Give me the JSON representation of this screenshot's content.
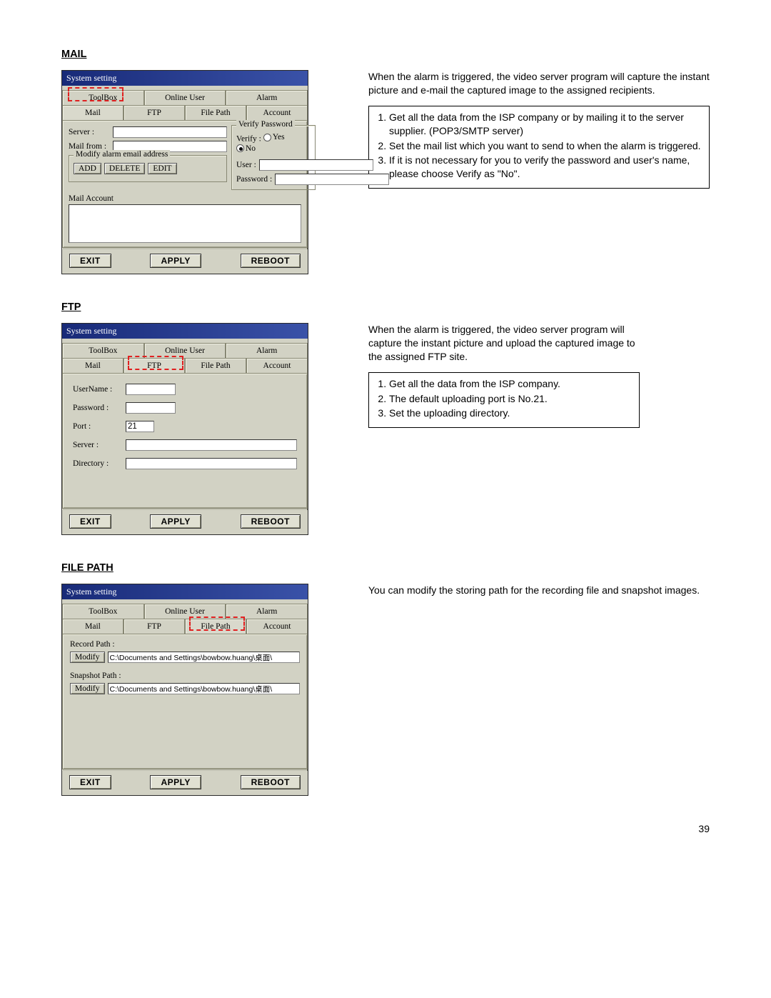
{
  "page": {
    "number": "39"
  },
  "sections": {
    "mail": {
      "heading": "MAIL",
      "dialog": {
        "title": "System setting",
        "tabs_top": [
          "ToolBox",
          "Online User",
          "Alarm"
        ],
        "tabs_bottom": [
          "Mail",
          "FTP",
          "File Path",
          "Account"
        ],
        "active_tab": "Mail",
        "labels": {
          "server": "Server :",
          "mail_from": "Mail from :",
          "modify_group": "Modify alarm email address",
          "verify_group": "Verify Password",
          "verify": "Verify :",
          "yes": "Yes",
          "no": "No",
          "user": "User :",
          "password": "Password :",
          "mail_account": "Mail Account"
        },
        "buttons": {
          "add": "ADD",
          "delete": "DELETE",
          "edit": "EDIT"
        },
        "footer": {
          "exit": "EXIT",
          "apply": "APPLY",
          "reboot": "REBOOT"
        },
        "values": {
          "server": "",
          "mail_from": "",
          "user": "",
          "password": "",
          "verify": "No"
        }
      },
      "desc": "When the alarm is triggered, the video server program will capture the instant picture and e-mail the captured image to the assigned recipients.",
      "notes": [
        "Get all the data from the ISP company or by mailing it to the server supplier. (POP3/SMTP server)",
        "Set the mail list which you want to send to when the alarm is triggered.",
        "If it is not necessary for you to verify the password and user's name, please choose Verify as \"No\"."
      ]
    },
    "ftp": {
      "heading": "FTP",
      "dialog": {
        "title": "System setting",
        "tabs_top": [
          "ToolBox",
          "Online User",
          "Alarm"
        ],
        "tabs_bottom": [
          "Mail",
          "FTP",
          "File Path",
          "Account"
        ],
        "active_tab": "FTP",
        "labels": {
          "username": "UserName :",
          "password": "Password :",
          "port": "Port :",
          "server": "Server :",
          "directory": "Directory :"
        },
        "footer": {
          "exit": "EXIT",
          "apply": "APPLY",
          "reboot": "REBOOT"
        },
        "values": {
          "username": "",
          "password": "",
          "port": "21",
          "server": "",
          "directory": ""
        }
      },
      "desc": "When the alarm is triggered, the video server program will capture the instant picture and upload the captured image to the assigned FTP site.",
      "notes": [
        "Get all the data from the ISP company.",
        "The default uploading port is No.21.",
        "Set the uploading directory."
      ]
    },
    "filepath": {
      "heading": "FILE PATH",
      "dialog": {
        "title": "System setting",
        "tabs_top": [
          "ToolBox",
          "Online User",
          "Alarm"
        ],
        "tabs_bottom": [
          "Mail",
          "FTP",
          "File Path",
          "Account"
        ],
        "active_tab": "File Path",
        "labels": {
          "record": "Record Path :",
          "snapshot": "Snapshot Path :",
          "modify": "Modify"
        },
        "footer": {
          "exit": "EXIT",
          "apply": "APPLY",
          "reboot": "REBOOT"
        },
        "values": {
          "record": "C:\\Documents and Settings\\bowbow.huang\\桌面\\",
          "snapshot": "C:\\Documents and Settings\\bowbow.huang\\桌面\\"
        }
      },
      "desc": "You can modify the storing path for the recording file and snapshot images."
    }
  }
}
